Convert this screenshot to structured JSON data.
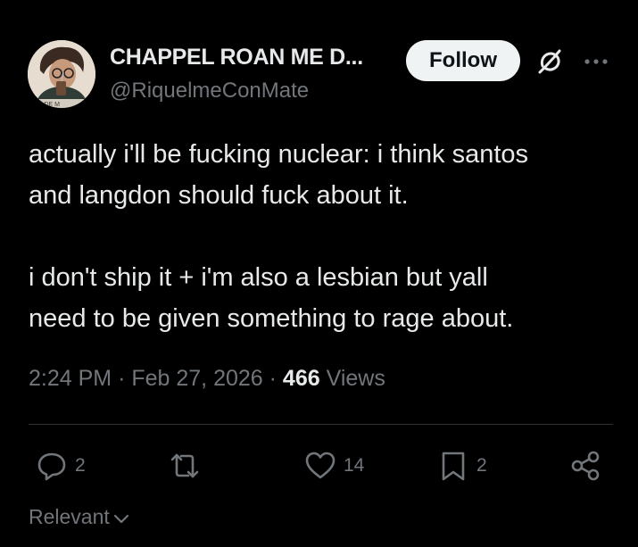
{
  "author": {
    "display_name": "CHAPPEL ROAN ME D...",
    "handle": "@RiquelmeConMate",
    "avatar_caption": "DO DE M"
  },
  "header": {
    "follow_label": "Follow",
    "grok_icon": "grok-icon",
    "more_icon": "more-dots-icon"
  },
  "tweet": {
    "lines": [
      "actually i'll be fucking nuclear: i think santos",
      "and langdon should fuck about it.",
      "i don't ship it + i'm also a lesbian but yall",
      "need to be given something to rage about."
    ]
  },
  "meta": {
    "time": "2:24 PM",
    "separator": "·",
    "date": "Feb 27, 2026",
    "views_count": "466",
    "views_label": "Views"
  },
  "actions": {
    "reply_count": "2",
    "retweet_count": "",
    "like_count": "14",
    "bookmark_count": "2"
  },
  "sort": {
    "label": "Relevant"
  },
  "colors": {
    "background": "#000000",
    "text_primary": "#e7e9ea",
    "text_secondary": "#71767b",
    "follow_bg": "#eff3f4",
    "divider": "#2f3336"
  }
}
